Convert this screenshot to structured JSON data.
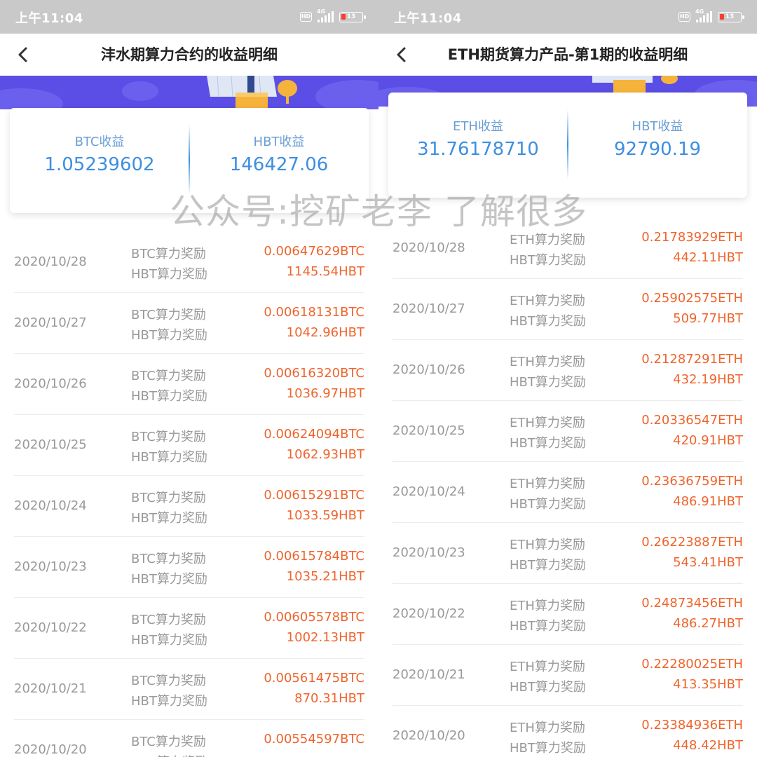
{
  "watermark": "公众号:挖矿老李 了解很多",
  "left": {
    "status": {
      "time": "上午11:04",
      "network": "4G",
      "battery": "13"
    },
    "title": "沣水期算力合约的收益明细",
    "summary": {
      "label_a": "BTC收益",
      "value_a": "1.05239602",
      "label_b": "HBT收益",
      "value_b": "146427.06"
    },
    "rows": [
      {
        "date": "2020/10/28",
        "t1": "BTC算力奖励",
        "t2": "HBT算力奖励",
        "v1": "0.00647629BTC",
        "v2": "1145.54HBT"
      },
      {
        "date": "2020/10/27",
        "t1": "BTC算力奖励",
        "t2": "HBT算力奖励",
        "v1": "0.00618131BTC",
        "v2": "1042.96HBT"
      },
      {
        "date": "2020/10/26",
        "t1": "BTC算力奖励",
        "t2": "HBT算力奖励",
        "v1": "0.00616320BTC",
        "v2": "1036.97HBT"
      },
      {
        "date": "2020/10/25",
        "t1": "BTC算力奖励",
        "t2": "HBT算力奖励",
        "v1": "0.00624094BTC",
        "v2": "1062.93HBT"
      },
      {
        "date": "2020/10/24",
        "t1": "BTC算力奖励",
        "t2": "HBT算力奖励",
        "v1": "0.00615291BTC",
        "v2": "1033.59HBT"
      },
      {
        "date": "2020/10/23",
        "t1": "BTC算力奖励",
        "t2": "HBT算力奖励",
        "v1": "0.00615784BTC",
        "v2": "1035.21HBT"
      },
      {
        "date": "2020/10/22",
        "t1": "BTC算力奖励",
        "t2": "HBT算力奖励",
        "v1": "0.00605578BTC",
        "v2": "1002.13HBT"
      },
      {
        "date": "2020/10/21",
        "t1": "BTC算力奖励",
        "t2": "HBT算力奖励",
        "v1": "0.00561475BTC",
        "v2": "870.31HBT"
      },
      {
        "date": "2020/10/20",
        "t1": "BTC算力奖励",
        "t2": "HBT算力奖励",
        "v1": "0.00554597BTC",
        "v2": ""
      }
    ]
  },
  "right": {
    "status": {
      "time": "上午11:04",
      "network": "4G",
      "battery": "13"
    },
    "title": "ETH期货算力产品-第1期的收益明细",
    "summary": {
      "label_a": "ETH收益",
      "value_a": "31.76178710",
      "label_b": "HBT收益",
      "value_b": "92790.19"
    },
    "rows": [
      {
        "date": "2020/10/28",
        "t1": "ETH算力奖励",
        "t2": "HBT算力奖励",
        "v1": "0.21783929ETH",
        "v2": "442.11HBT"
      },
      {
        "date": "2020/10/27",
        "t1": "ETH算力奖励",
        "t2": "HBT算力奖励",
        "v1": "0.25902575ETH",
        "v2": "509.77HBT"
      },
      {
        "date": "2020/10/26",
        "t1": "ETH算力奖励",
        "t2": "HBT算力奖励",
        "v1": "0.21287291ETH",
        "v2": "432.19HBT"
      },
      {
        "date": "2020/10/25",
        "t1": "ETH算力奖励",
        "t2": "HBT算力奖励",
        "v1": "0.20336547ETH",
        "v2": "420.91HBT"
      },
      {
        "date": "2020/10/24",
        "t1": "ETH算力奖励",
        "t2": "HBT算力奖励",
        "v1": "0.23636759ETH",
        "v2": "486.91HBT"
      },
      {
        "date": "2020/10/23",
        "t1": "ETH算力奖励",
        "t2": "HBT算力奖励",
        "v1": "0.26223887ETH",
        "v2": "543.41HBT"
      },
      {
        "date": "2020/10/22",
        "t1": "ETH算力奖励",
        "t2": "HBT算力奖励",
        "v1": "0.24873456ETH",
        "v2": "486.27HBT"
      },
      {
        "date": "2020/10/21",
        "t1": "ETH算力奖励",
        "t2": "HBT算力奖励",
        "v1": "0.22280025ETH",
        "v2": "413.35HBT"
      },
      {
        "date": "2020/10/20",
        "t1": "ETH算力奖励",
        "t2": "HBT算力奖励",
        "v1": "0.23384936ETH",
        "v2": "448.42HBT"
      }
    ]
  }
}
